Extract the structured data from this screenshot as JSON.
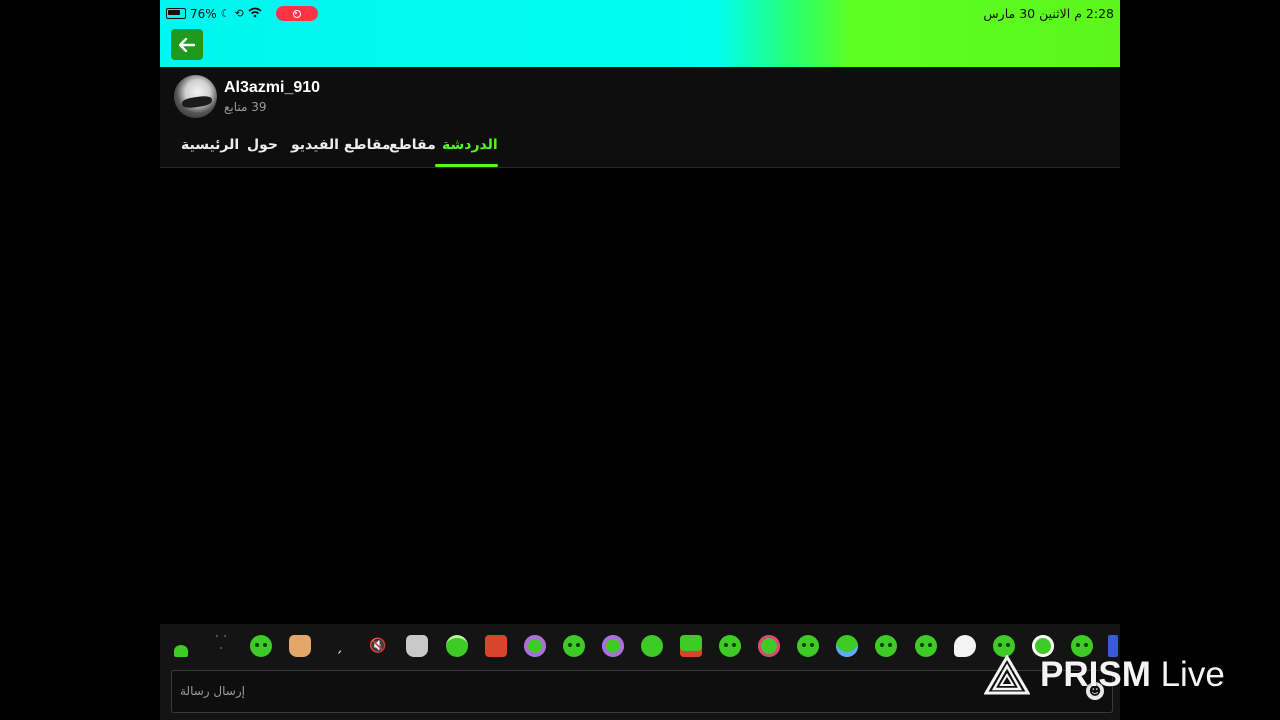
{
  "status_bar": {
    "battery": "76%",
    "datetime": "2:28 م  الاثنين 30 مارس"
  },
  "profile": {
    "channel_name": "Al3azmi_910",
    "followers": "39 متابع"
  },
  "tabs": [
    {
      "label": "الدردشة",
      "active": true
    },
    {
      "label": "مقاطع",
      "active": false
    },
    {
      "label": "مقاطع الفيديو",
      "active": false
    },
    {
      "label": "حول",
      "active": false
    },
    {
      "label": "الرئيسية",
      "active": false
    }
  ],
  "chat": {
    "input_placeholder": "إرسال رسالة"
  },
  "watermark": {
    "brand": "PRISM",
    "suffix": "Live"
  },
  "colors": {
    "accent": "#53fc18",
    "record": "#ff3347",
    "background": "#000000"
  }
}
